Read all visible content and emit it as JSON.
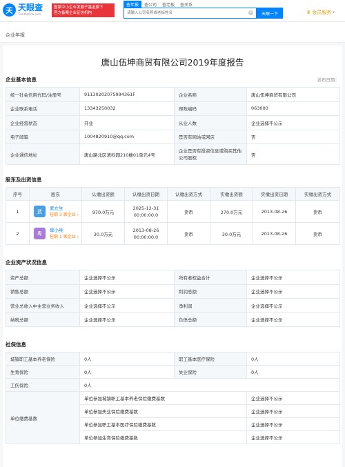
{
  "header": {
    "logo_mark": "天",
    "logo_cn": "天眼查",
    "logo_en": "TianYanCha.com",
    "banner_line1": "国家中小企业发展子基金旗下",
    "banner_line2": "官方备案企业征信机构",
    "search_tabs": [
      "查年报",
      "查公司",
      "查老板",
      "查关系"
    ],
    "search_placeholder": "请输入公司名称或老板姓名",
    "search_clear": "×",
    "search_button": "天眼一下",
    "member_label": "会员服务",
    "member_caret": "▾",
    "member_icon": "crown-icon",
    "member_color": "#e8a317",
    "accent_color": "#0084ff"
  },
  "breadcrumb": "企业年报",
  "report_title": "唐山伍坤商贸有限公司2019年度报告",
  "basic": {
    "title": "企业基本信息",
    "publish_label": "发布日期：",
    "rows": [
      [
        "统一社会信用代码/注册号",
        "91130202075994361F",
        "企业名称",
        "唐山伍坤商贸有限公司"
      ],
      [
        "企业联系电话",
        "13343250032",
        "邮政编码",
        "063000"
      ],
      [
        "企业经营状态",
        "开业",
        "从业人数",
        "企业选择不公示"
      ],
      [
        "电子邮箱",
        "1004820910@qq.com",
        "是否有网站或网店",
        "否"
      ],
      [
        "企业通信地址",
        "唐山路北区清科园210楼01单元4号",
        "企业是否有投资信息或购买其他公司股权",
        "否"
      ]
    ]
  },
  "shareholders": {
    "title": "股东及出资信息",
    "headers": [
      "序号",
      "股东",
      "认缴出资额",
      "认缴出资日期",
      "认缴出资方式",
      "实缴出资额",
      "实缴出资日期",
      "实缴出资方式"
    ],
    "rows": [
      {
        "no": "1",
        "avatar": "武",
        "avatar_color": "#4a9fe0",
        "name": "武立生",
        "sub": "任职 3 家企业 ›",
        "sub_amount": "970.0万元",
        "sub_date": "2025-12-31 00:00:00.0",
        "sub_method": "货币",
        "paid_amount": "270.0万元",
        "paid_date": "2013-08-26",
        "paid_method": "货币"
      },
      {
        "no": "2",
        "avatar": "卑",
        "avatar_color": "#a97ad6",
        "name": "卑小兵",
        "sub": "任职 1 家企业 ›",
        "sub_amount": "30.0万元",
        "sub_date": "2013-08-26 00:00:00.0",
        "sub_method": "货币",
        "paid_amount": "30.0万元",
        "paid_date": "2013-08-26",
        "paid_method": "货币"
      }
    ]
  },
  "assets": {
    "title": "企业资产状况信息",
    "rows": [
      [
        "资产总额",
        "企业选择不公示",
        "所有者权益合计",
        "企业选择不公示"
      ],
      [
        "销售总额",
        "企业选择不公示",
        "利润总额",
        "企业选择不公示"
      ],
      [
        "营业总收入中主营业务收入",
        "企业选择不公示",
        "净利润",
        "企业选择不公示"
      ],
      [
        "纳税总额",
        "企业选择不公示",
        "负债总额",
        "企业选择不公示"
      ]
    ]
  },
  "social": {
    "title": "社保信息",
    "rows": [
      [
        "城镇职工基本养老保险",
        "0人",
        "职工基本医疗保险",
        "0人"
      ],
      [
        "生育保险",
        "0人",
        "失业保险",
        "0人"
      ]
    ],
    "injury_label": "工伤保险",
    "injury_value": "0人",
    "base_label": "单位缴费基数",
    "base_rows": [
      [
        "单位参加城镇职工基本养老保险缴费基数",
        "企业选择不公示"
      ],
      [
        "单位参加失业保险缴费基数",
        "企业选择不公示"
      ],
      [
        "单位参加职工基本医疗保险缴费基数",
        "企业选择不公示"
      ],
      [
        "单位参加生育保险缴费基数",
        "企业选择不公示"
      ]
    ]
  }
}
